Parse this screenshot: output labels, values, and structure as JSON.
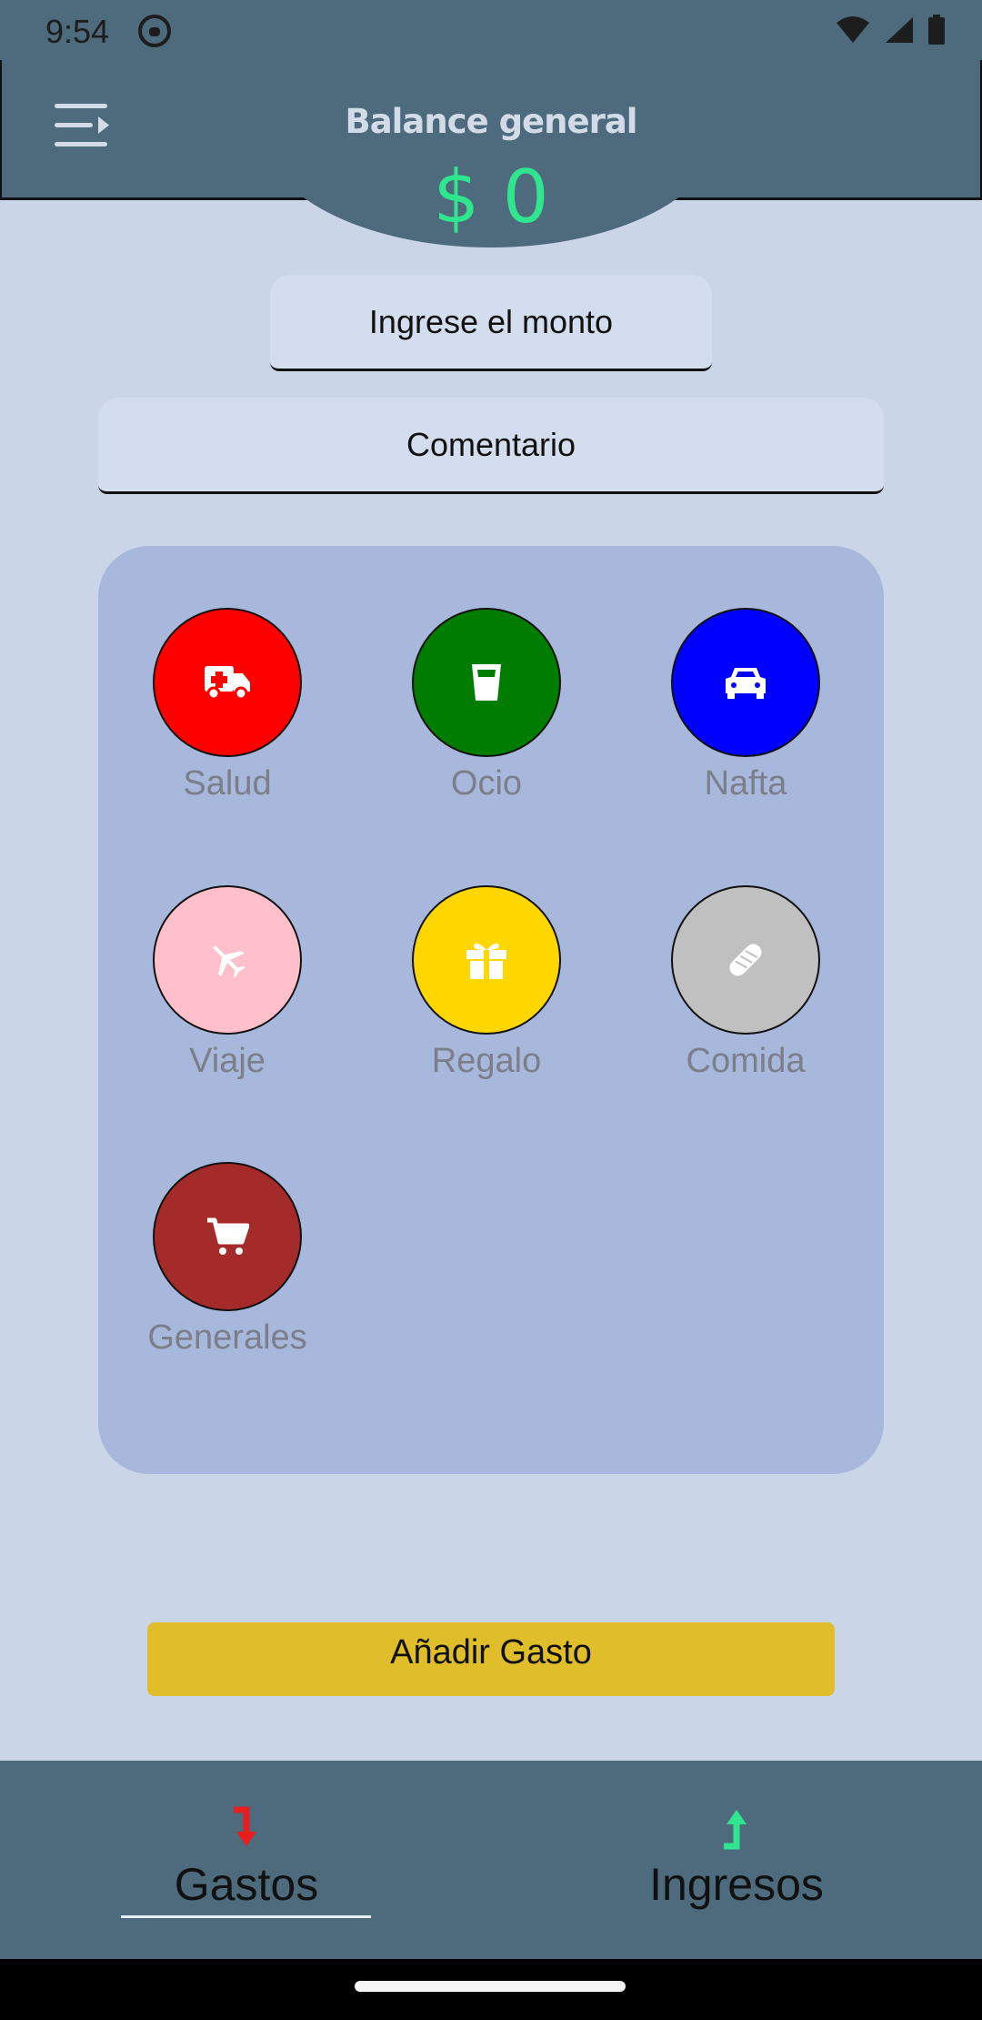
{
  "status_bar": {
    "time": "9:54",
    "icons": [
      "notification-icon",
      "wifi-icon",
      "signal-icon",
      "battery-icon"
    ]
  },
  "header": {
    "menu_icon": "menu-icon",
    "title": "Balance general",
    "amount": "$ 0"
  },
  "form": {
    "amount_placeholder": "Ingrese el monto",
    "comment_placeholder": "Comentario"
  },
  "categories": [
    {
      "label": "Salud",
      "icon": "ambulance-icon",
      "color": "#ff0000"
    },
    {
      "label": "Ocio",
      "icon": "glass-icon",
      "color": "#007d00"
    },
    {
      "label": "Nafta",
      "icon": "car-icon",
      "color": "#0000ff"
    },
    {
      "label": "Viaje",
      "icon": "airplane-icon",
      "color": "#ffc0cb"
    },
    {
      "label": "Regalo",
      "icon": "gift-icon",
      "color": "#ffd700"
    },
    {
      "label": "Comida",
      "icon": "bread-icon",
      "color": "#c0c0c0"
    },
    {
      "label": "Generales",
      "icon": "cart-icon",
      "color": "#a52a2a"
    }
  ],
  "add_button": {
    "label": "Añadir Gasto",
    "color": "#e0bd2a"
  },
  "bottom_nav": {
    "tabs": [
      {
        "label": "Gastos",
        "icon": "arrow-down-icon",
        "active": true
      },
      {
        "label": "Ingresos",
        "icon": "arrow-up-icon",
        "active": false
      }
    ]
  },
  "colors": {
    "header": "#4d6b7d",
    "background": "#cbd5e8",
    "panel": "#a7b8dc",
    "balance": "#2fe58e"
  }
}
